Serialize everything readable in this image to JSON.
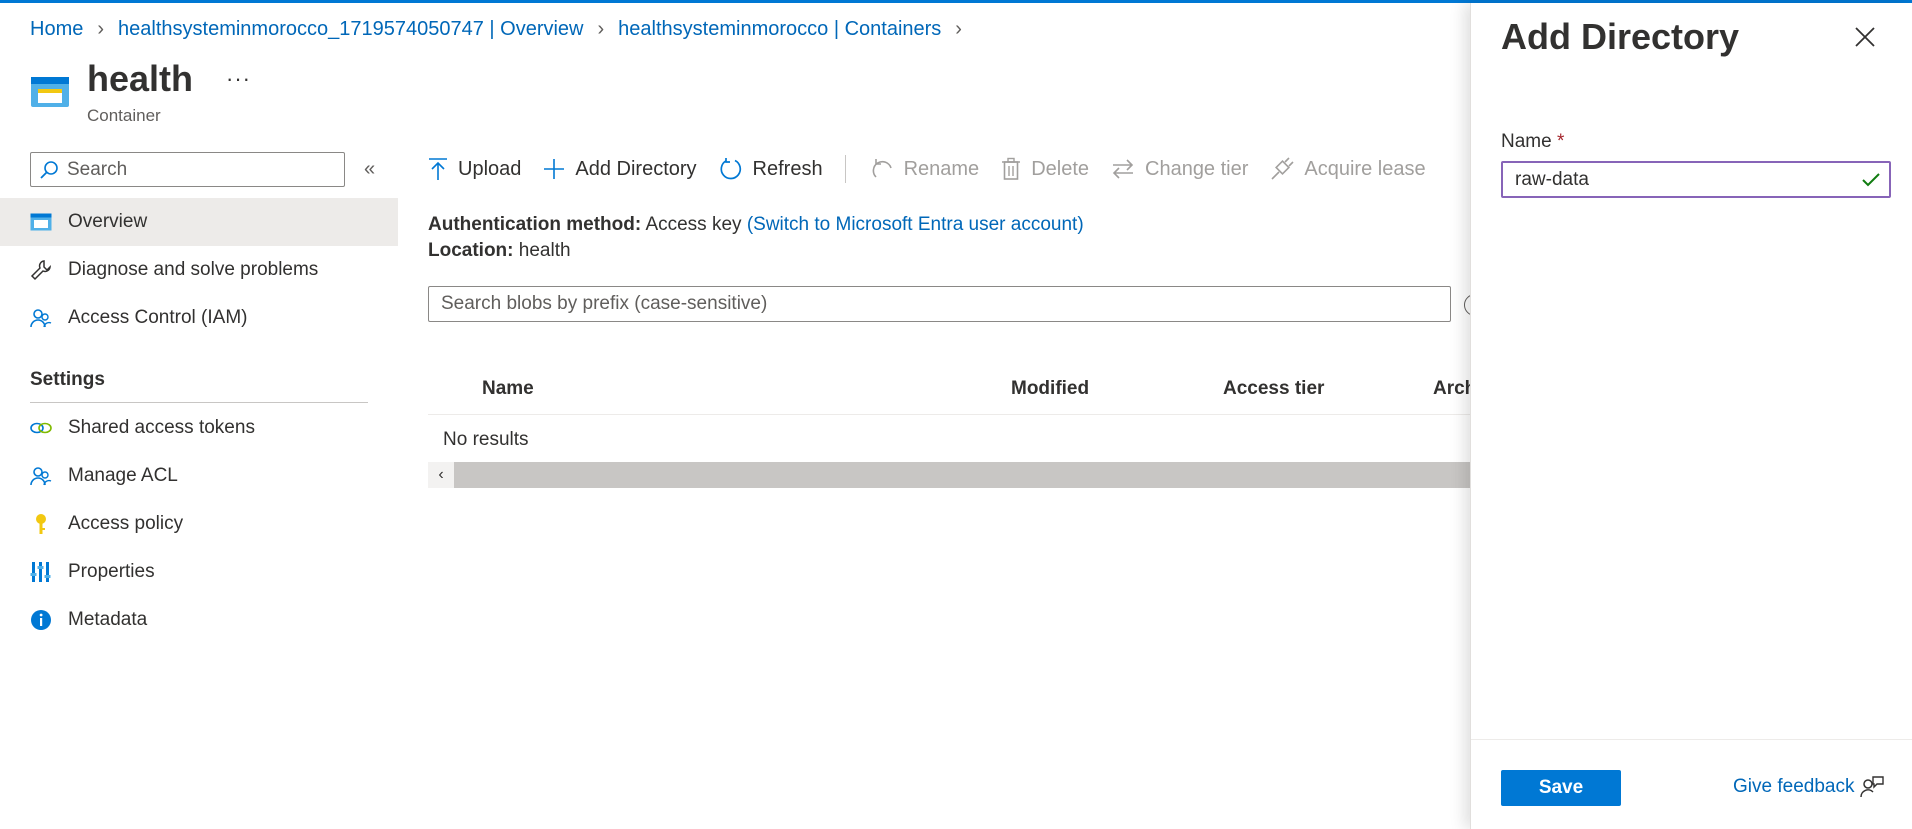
{
  "breadcrumb": {
    "items": [
      "Home",
      "healthsysteminmorocco_1719574050747 | Overview",
      "healthsysteminmorocco | Containers"
    ]
  },
  "resource": {
    "title": "health",
    "subtitle": "Container",
    "more": "···"
  },
  "sidebar": {
    "search_placeholder": "Search",
    "collapse": "«",
    "items": [
      {
        "label": "Overview",
        "icon": "container-icon"
      },
      {
        "label": "Diagnose and solve problems",
        "icon": "wrench-icon"
      },
      {
        "label": "Access Control (IAM)",
        "icon": "people-icon"
      }
    ],
    "settings_heading": "Settings",
    "settings_items": [
      {
        "label": "Shared access tokens",
        "icon": "link-icon"
      },
      {
        "label": "Manage ACL",
        "icon": "people-icon"
      },
      {
        "label": "Access policy",
        "icon": "key-icon"
      },
      {
        "label": "Properties",
        "icon": "properties-icon"
      },
      {
        "label": "Metadata",
        "icon": "info-icon"
      }
    ]
  },
  "toolbar": {
    "upload": "Upload",
    "add_directory": "Add Directory",
    "refresh": "Refresh",
    "rename": "Rename",
    "delete": "Delete",
    "change_tier": "Change tier",
    "acquire_lease": "Acquire lease"
  },
  "info": {
    "auth_label": "Authentication method:",
    "auth_value": "Access key",
    "auth_link": "(Switch to Microsoft Entra user account)",
    "location_label": "Location:",
    "location_value": "health"
  },
  "blob_search": {
    "placeholder": "Search blobs by prefix (case-sensitive)"
  },
  "table": {
    "columns": [
      "Name",
      "Modified",
      "Access tier",
      "Arch"
    ],
    "empty_text": "No results"
  },
  "panel": {
    "title": "Add Directory",
    "field_label": "Name",
    "required_mark": "*",
    "field_value": "raw-data",
    "save_label": "Save",
    "feedback_label": "Give feedback"
  },
  "colors": {
    "accent": "#0078d4",
    "link": "#0067b8",
    "input_focus": "#8764b8",
    "valid": "#107c10"
  }
}
